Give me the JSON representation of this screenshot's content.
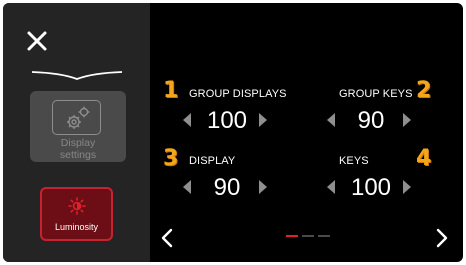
{
  "sidebar": {
    "display_settings_label": "Display\nsettings",
    "luminosity_label": "Luminosity"
  },
  "controls": [
    {
      "badge": "1",
      "label": "GROUP DISPLAYS",
      "value": "100"
    },
    {
      "badge": "2",
      "label": "GROUP KEYS",
      "value": "90"
    },
    {
      "badge": "3",
      "label": "DISPLAY",
      "value": "90"
    },
    {
      "badge": "4",
      "label": "KEYS",
      "value": "100"
    }
  ],
  "pagination": {
    "pages": 3,
    "current": 1
  },
  "colors": {
    "accent": "#e0202e",
    "badge": "#f5a519",
    "sidebar_bg": "#242424",
    "luminosity_bg": "#6d0e16"
  },
  "icons": [
    "close-icon",
    "gear-icon",
    "sun-icon",
    "chevron-left-icon",
    "chevron-right-icon"
  ]
}
